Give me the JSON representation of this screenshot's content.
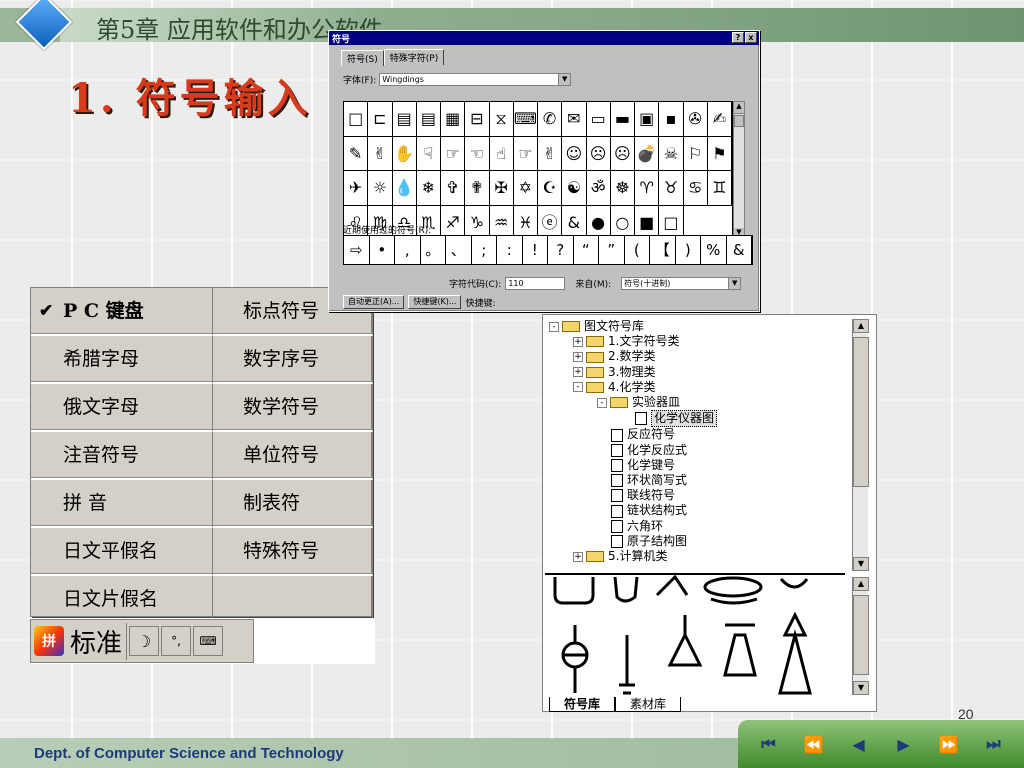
{
  "slide": {
    "chapter_title": "第5章  应用软件和办公软件",
    "heading": "1. 符号输入",
    "footer": "Dept. of Computer Science and Technology",
    "page_number": "20"
  },
  "dialog": {
    "title": "符号",
    "help": "?",
    "close": "x",
    "tabs": [
      "符号(S)",
      "特殊字符(P)"
    ],
    "font_label": "字体(F):",
    "font_value": "Wingdings",
    "symbols": [
      "□",
      "⊏",
      "▤",
      "▤",
      "▦",
      "⊟",
      "⧖",
      "⌨",
      "✆",
      "✉",
      "▭",
      "▬",
      "▣",
      "▪",
      "✇",
      "✍",
      "✎",
      "✌",
      "✋",
      "☟",
      "☞",
      "☜",
      "☝",
      "☞",
      "✌",
      "☺",
      "☹",
      "☹",
      "💣",
      "☠",
      "⚐",
      "⚑",
      "✈",
      "☼",
      "💧",
      "❄",
      "✞",
      "✟",
      "✠",
      "✡",
      "☪",
      "☯",
      "ॐ",
      "☸",
      "♈",
      "♉",
      "♋",
      "♊",
      "♌",
      "♍",
      "♎",
      "♏",
      "♐",
      "♑",
      "♒",
      "♓",
      "ⓔ",
      "&",
      "●",
      "○",
      "■",
      "□"
    ],
    "selected_index": 62,
    "recent_label": "近期使用过的符号(R):",
    "recent": [
      "⇨",
      "•",
      ",",
      "。",
      "、",
      ";",
      ":",
      "!",
      "?",
      "“",
      "”",
      "(",
      "【",
      ")",
      "%",
      "&"
    ],
    "code_label": "字符代码(C):",
    "code_value": "110",
    "from_label": "来自(M):",
    "from_value": "符号(十进制)",
    "autocorrect": "自动更正(A)...",
    "shortcut_btn": "快捷键(K)...",
    "shortcut_label": "快捷键:"
  },
  "softkb_menu": {
    "col1": [
      "P C 键盘",
      "希腊字母",
      "俄文字母",
      "注音符号",
      "拼    音",
      "日文平假名",
      "日文片假名"
    ],
    "col2": [
      "标点符号",
      "数字序号",
      "数学符号",
      "单位符号",
      "制表符",
      "特殊符号",
      ""
    ],
    "checked_item": "P C 键盘"
  },
  "ime_bar": {
    "mode_label": "标准",
    "punct_icon": "moon-icon",
    "dot_icon": "punct-icon",
    "kb_icon": "keyboard-icon"
  },
  "tree": {
    "nodes": [
      {
        "level": 0,
        "exp": "-",
        "type": "folder",
        "label": "图文符号库"
      },
      {
        "level": 1,
        "exp": "+",
        "type": "folder",
        "label": "1.文字符号类"
      },
      {
        "level": 1,
        "exp": "+",
        "type": "folder",
        "label": "2.数学类"
      },
      {
        "level": 1,
        "exp": "+",
        "type": "folder",
        "label": "3.物理类"
      },
      {
        "level": 1,
        "exp": "-",
        "type": "folder",
        "label": "4.化学类"
      },
      {
        "level": 2,
        "exp": "-",
        "type": "folder",
        "label": "实验器皿"
      },
      {
        "level": 3,
        "exp": "",
        "type": "doc",
        "label": "化学仪器图",
        "selected": true
      },
      {
        "level": 2,
        "exp": "",
        "type": "doc",
        "label": "反应符号"
      },
      {
        "level": 2,
        "exp": "",
        "type": "doc",
        "label": "化学反应式"
      },
      {
        "level": 2,
        "exp": "",
        "type": "doc",
        "label": "化学键号"
      },
      {
        "level": 2,
        "exp": "",
        "type": "doc",
        "label": "环状简写式"
      },
      {
        "level": 2,
        "exp": "",
        "type": "doc",
        "label": "联线符号"
      },
      {
        "level": 2,
        "exp": "",
        "type": "doc",
        "label": "链状结构式"
      },
      {
        "level": 2,
        "exp": "",
        "type": "doc",
        "label": "六角环"
      },
      {
        "level": 2,
        "exp": "",
        "type": "doc",
        "label": "原子结构图"
      },
      {
        "level": 1,
        "exp": "+",
        "type": "folder",
        "label": "5.计算机类"
      }
    ],
    "bottom_tabs": [
      "符号库",
      "素材库"
    ]
  },
  "nav": [
    "⏮",
    "⏪",
    "◀",
    "▶",
    "⏩",
    "⏭"
  ],
  "colors": {
    "heading": "#d93a1b",
    "title_bar": "#000080",
    "footer_text": "#1f3a7a"
  }
}
